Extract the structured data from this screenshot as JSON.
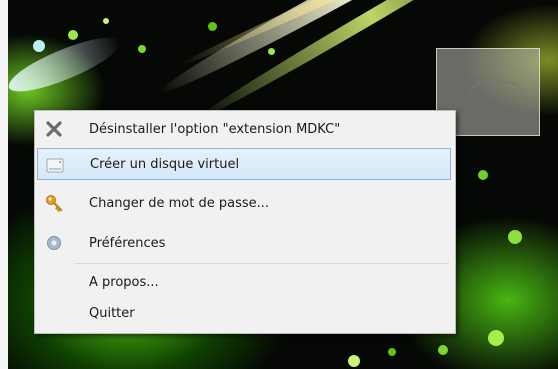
{
  "menu": {
    "items": [
      {
        "label": "Désinstaller l'option \"extension MDKC\"",
        "icon": "close-x-icon"
      },
      {
        "label": "Créer un disque virtuel",
        "icon": "disk-drive-icon",
        "highlighted": true
      },
      {
        "label": "Changer de mot de passe...",
        "icon": "key-icon"
      },
      {
        "label": "Préférences",
        "icon": "gear-icon"
      },
      {
        "label": "A propos...",
        "icon": ""
      },
      {
        "label": "Quitter",
        "icon": ""
      }
    ]
  },
  "colors": {
    "highlight": "#d6e8f8",
    "highlight_border": "#8bb5df",
    "wallpaper_green": "#5ad214"
  }
}
